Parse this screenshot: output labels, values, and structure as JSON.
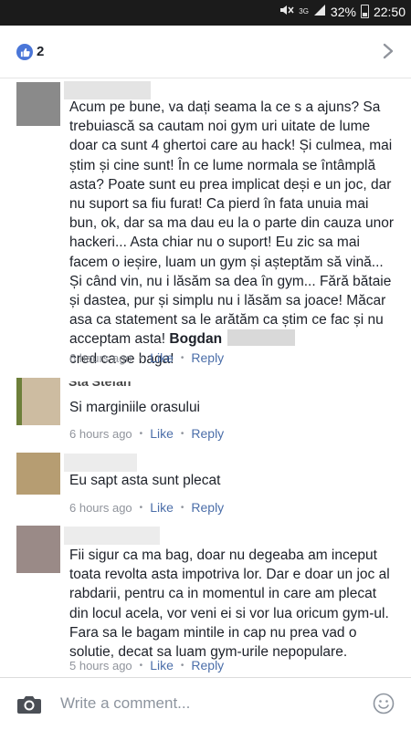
{
  "statusbar": {
    "battery": "32%",
    "time": "22:50",
    "network": "3G"
  },
  "header": {
    "like_count": "2"
  },
  "comments": [
    {
      "text": "Acum pe bune,  va dați seama la ce s a ajuns? Sa trebuiască sa cautam noi gym uri uitate de lume doar ca sunt 4 ghertoi care au hack! Și culmea, mai știm și cine sunt! În ce lume normala se întâmplă asta? Poate sunt eu prea implicat  deși e un joc,  dar nu suport sa fiu furat! Ca pierd în fata unuia mai bun,  ok,  dar sa ma dau eu la o parte din cauza unor hackeri... Asta chiar nu o suport! Eu zic sa mai facem o ieșire,  luam un gym și așteptăm să vină... Și când vin,  nu i lăsăm sa dea în gym... Fără bătaie și dastea,  pur și simplu nu i lăsăm sa joace! Măcar asa ca statement sa le arătăm ca știm ce fac și nu acceptam asta! ",
      "mention": "Bogdan",
      "text_after": "cred ca se baga!",
      "time": "6 hours ago",
      "like": "Like",
      "reply": "Reply"
    },
    {
      "author_partial": "Sta Stefan",
      "text": "Si marginiile orasului",
      "time": "6 hours ago",
      "like": "Like",
      "reply": "Reply"
    },
    {
      "text": "Eu sapt asta sunt plecat",
      "time": "6 hours ago",
      "like": "Like",
      "reply": "Reply"
    },
    {
      "text": "Fii sigur ca ma bag, doar nu degeaba am inceput toata revolta asta impotriva lor. Dar e doar un joc al rabdarii, pentru ca in momentul in care am plecat din locul acela, vor veni ei si vor lua oricum gym-ul. Fara sa le bagam mintile in cap nu prea vad o solutie, decat sa luam gym-urile nepopulare.",
      "time": "5 hours ago",
      "like": "Like",
      "reply": "Reply"
    }
  ],
  "composer": {
    "placeholder": "Write a comment..."
  },
  "icons": {
    "like_badge": "thumbs-up-icon",
    "chevron": "chevron-right-icon",
    "camera": "camera-icon",
    "emoji": "smiley-icon"
  },
  "colors": {
    "link": "#4b6ea9",
    "like_badge": "#4a76d8",
    "meta": "#90949c"
  }
}
